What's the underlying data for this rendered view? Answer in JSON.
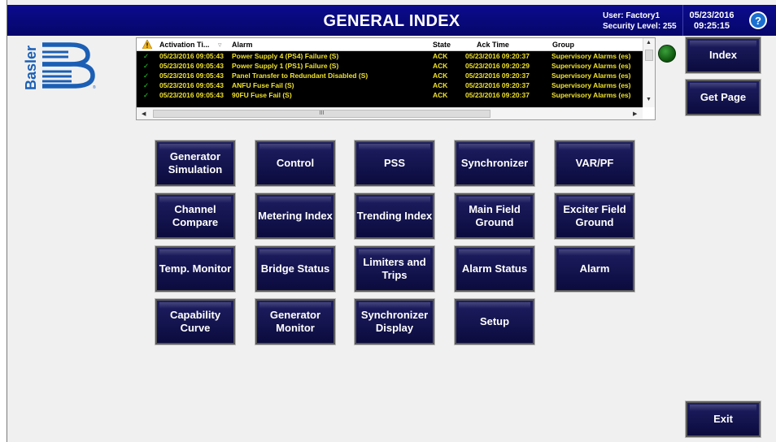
{
  "header": {
    "title": "GENERAL INDEX",
    "user": "User: Factory1",
    "security": "Security Level: 255",
    "date": "05/23/2016",
    "time": "09:25:15",
    "help_icon": "?"
  },
  "logo": {
    "text": "Basler",
    "brand_color": "#1b5fb5"
  },
  "alarm_grid": {
    "columns": [
      "Activation Ti...",
      "Alarm",
      "State",
      "Ack Time",
      "Group"
    ],
    "rows": [
      {
        "activation": "05/23/2016 09:05:43",
        "alarm": "Power Supply 4 (PS4) Failure (S)",
        "state": "ACK",
        "ack_time": "05/23/2016 09:20:37",
        "group": "Supervisory Alarms (es)"
      },
      {
        "activation": "05/23/2016 09:05:43",
        "alarm": "Power Supply 1 (PS1) Failure (S)",
        "state": "ACK",
        "ack_time": "05/23/2016 09:20:29",
        "group": "Supervisory Alarms (es)"
      },
      {
        "activation": "05/23/2016 09:05:43",
        "alarm": "Panel Transfer to Redundant Disabled (S)",
        "state": "ACK",
        "ack_time": "05/23/2016 09:20:37",
        "group": "Supervisory Alarms (es)"
      },
      {
        "activation": "05/23/2016 09:05:43",
        "alarm": "ANFU Fuse Fail (S)",
        "state": "ACK",
        "ack_time": "05/23/2016 09:20:37",
        "group": "Supervisory Alarms (es)"
      },
      {
        "activation": "05/23/2016 09:05:43",
        "alarm": "90FU Fuse Fail (S)",
        "state": "ACK",
        "ack_time": "05/23/2016 09:20:37",
        "group": "Supervisory Alarms (es)"
      }
    ],
    "hscroll_thumb": "III"
  },
  "side_buttons": {
    "index": "Index",
    "get_page": "Get Page",
    "exit": "Exit"
  },
  "grid_buttons": [
    [
      "Generator Simulation",
      "Control",
      "PSS",
      "Synchronizer",
      "VAR/PF"
    ],
    [
      "Channel Compare",
      "Metering Index",
      "Trending Index",
      "Main Field Ground",
      "Exciter Field Ground"
    ],
    [
      "Temp. Monitor",
      "Bridge Status",
      "Limiters and Trips",
      "Alarm Status",
      "Alarm"
    ],
    [
      "Capability Curve",
      "Generator Monitor",
      "Synchronizer Display",
      "Setup"
    ]
  ],
  "colors": {
    "header_bg": "#08087c",
    "button_bg": "#13134f",
    "alarm_text": "#f0e22a",
    "ack_check": "#2bd12b",
    "status_led": "#1a7a1a"
  }
}
